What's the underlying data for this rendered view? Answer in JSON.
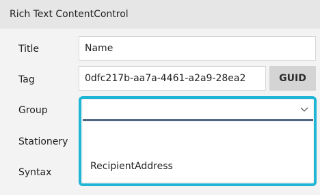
{
  "header": {
    "title": "Rich Text ContentControl"
  },
  "fields": {
    "title_label": "Title",
    "title_value": "Name",
    "tag_label": "Tag",
    "tag_value": "0dfc217b-aa7a-4461-a2a9-28ea2",
    "guid_button": "GUID",
    "group_label": "Group",
    "group_value": "",
    "stationery_label": "Stationery",
    "syntax_label": "Syntax"
  },
  "group_dropdown": {
    "open": true,
    "options": [
      "",
      "RecipientAddress"
    ],
    "icon": "chevron-down-icon"
  },
  "colors": {
    "highlight": "#1fb6d6",
    "header_bg": "#e6e6e6",
    "panel_bg": "#f3f3f3",
    "guid_button_bg": "#d4d4d4"
  }
}
